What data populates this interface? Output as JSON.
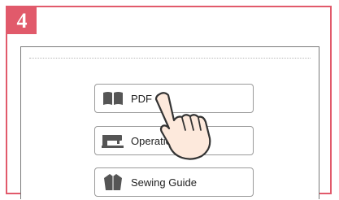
{
  "step": {
    "number": "4"
  },
  "menu": {
    "items": [
      {
        "label": "PDF",
        "icon": "book-icon"
      },
      {
        "label": "Operatio",
        "icon": "sewing-machine-icon"
      },
      {
        "label": "Sewing Guide",
        "icon": "shirt-icon"
      }
    ]
  },
  "overlay": {
    "icon": "pointing-hand-icon"
  },
  "colors": {
    "accent": "#e15a6b"
  }
}
